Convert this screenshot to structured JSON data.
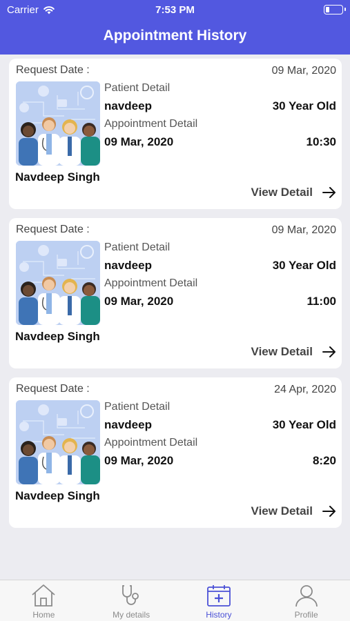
{
  "status_bar": {
    "carrier": "Carrier",
    "time": "7:53 PM",
    "battery_level": 0.25
  },
  "header": {
    "title": "Appointment History"
  },
  "appointments": [
    {
      "request_label": "Request Date :",
      "request_date": "09 Mar, 2020",
      "patient_label": "Patient Detail",
      "patient_name": "navdeep",
      "patient_age": "30 Year Old",
      "appointment_label": "Appointment Detail",
      "appointment_date": "09 Mar, 2020",
      "appointment_time": "10:30",
      "doctor_name": "Navdeep Singh",
      "view_label": "View Detail"
    },
    {
      "request_label": "Request Date :",
      "request_date": "09 Mar, 2020",
      "patient_label": "Patient Detail",
      "patient_name": "navdeep",
      "patient_age": "30 Year Old",
      "appointment_label": "Appointment Detail",
      "appointment_date": "09 Mar, 2020",
      "appointment_time": "11:00",
      "doctor_name": "Navdeep Singh",
      "view_label": "View Detail"
    },
    {
      "request_label": "Request Date :",
      "request_date": "24 Apr, 2020",
      "patient_label": "Patient Detail",
      "patient_name": "navdeep",
      "patient_age": "30 Year Old",
      "appointment_label": "Appointment Detail",
      "appointment_date": "09 Mar, 2020",
      "appointment_time": "8:20",
      "doctor_name": "Navdeep Singh",
      "view_label": "View Detail"
    }
  ],
  "tabbar": {
    "active": "History",
    "items": [
      {
        "label": "Home",
        "icon": "home-icon"
      },
      {
        "label": "My details",
        "icon": "stethoscope-icon"
      },
      {
        "label": "History",
        "icon": "calendar-medical-icon"
      },
      {
        "label": "Profile",
        "icon": "person-icon"
      }
    ]
  },
  "colors": {
    "primary": "#5258e0",
    "active_tab": "#4a50d6",
    "background": "#ececf1"
  }
}
